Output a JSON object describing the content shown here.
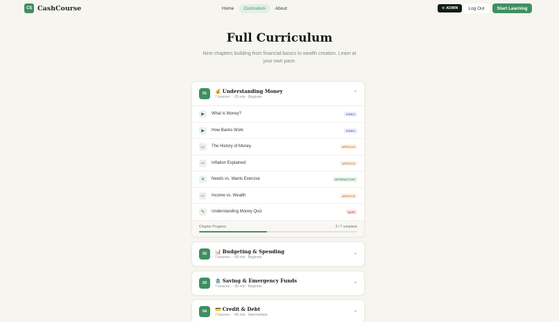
{
  "nav": {
    "logo_mark": "C$",
    "logo_text": "CashCourse",
    "links": [
      {
        "label": "Home",
        "active": false
      },
      {
        "label": "Curriculum",
        "active": true
      },
      {
        "label": "About",
        "active": false
      }
    ],
    "admin_label": "⚙ ADMIN",
    "logout_label": "Log Out",
    "start_label": "Start Learning"
  },
  "hero": {
    "title": "Full Curriculum",
    "subtitle": "Nine chapters building from financial basics to wealth creation. Learn at your own pace."
  },
  "chapters": [
    {
      "num": "01",
      "emoji": "💰",
      "title": "Understanding Money",
      "meta": "7 lessons · ~35 min · Beginner",
      "chevron": "⌃",
      "expanded": true,
      "lessons": [
        {
          "icon": "play-icon",
          "glyph": "▶",
          "title": "What is Money?",
          "badge": "VIDEO",
          "type": "video"
        },
        {
          "icon": "play-icon",
          "glyph": "▶",
          "title": "How Banks Work",
          "badge": "VIDEO",
          "type": "video"
        },
        {
          "icon": "book-icon",
          "glyph": "📖",
          "title": "The History of Money",
          "badge": "ARTICLE",
          "type": "article"
        },
        {
          "icon": "book-icon",
          "glyph": "📖",
          "title": "Inflation Explained",
          "badge": "ARTICLE",
          "type": "article"
        },
        {
          "icon": "tools-icon",
          "glyph": "✕",
          "title": "Needs vs. Wants Exercise",
          "badge": "INTERACTIVE",
          "type": "interactive"
        },
        {
          "icon": "book-icon",
          "glyph": "📖",
          "title": "Income vs. Wealth",
          "badge": "ARTICLE",
          "type": "article"
        },
        {
          "icon": "pencil-icon",
          "glyph": "✎",
          "title": "Understanding Money Quiz",
          "badge": "QUIZ",
          "type": "quiz"
        }
      ],
      "progress_label": "Chapter Progress",
      "progress_count": "3 / 7 complete",
      "progress_fraction": 0.43
    },
    {
      "num": "02",
      "emoji": "📊",
      "title": "Budgeting & Spending",
      "meta": "7 lessons · ~38 min · Beginner",
      "chevron": "⌄",
      "expanded": false
    },
    {
      "num": "03",
      "emoji": "🏦",
      "title": "Saving & Emergency Funds",
      "meta": "7 lessons · ~36 min · Beginner",
      "chevron": "⌄",
      "expanded": false
    },
    {
      "num": "04",
      "emoji": "💳",
      "title": "Credit & Debt",
      "meta": "7 lessons · ~40 min · Intermediate",
      "chevron": "⌄",
      "expanded": false
    }
  ],
  "colors": {
    "accent": "#3f8f62",
    "background": "#f7f5f0"
  }
}
